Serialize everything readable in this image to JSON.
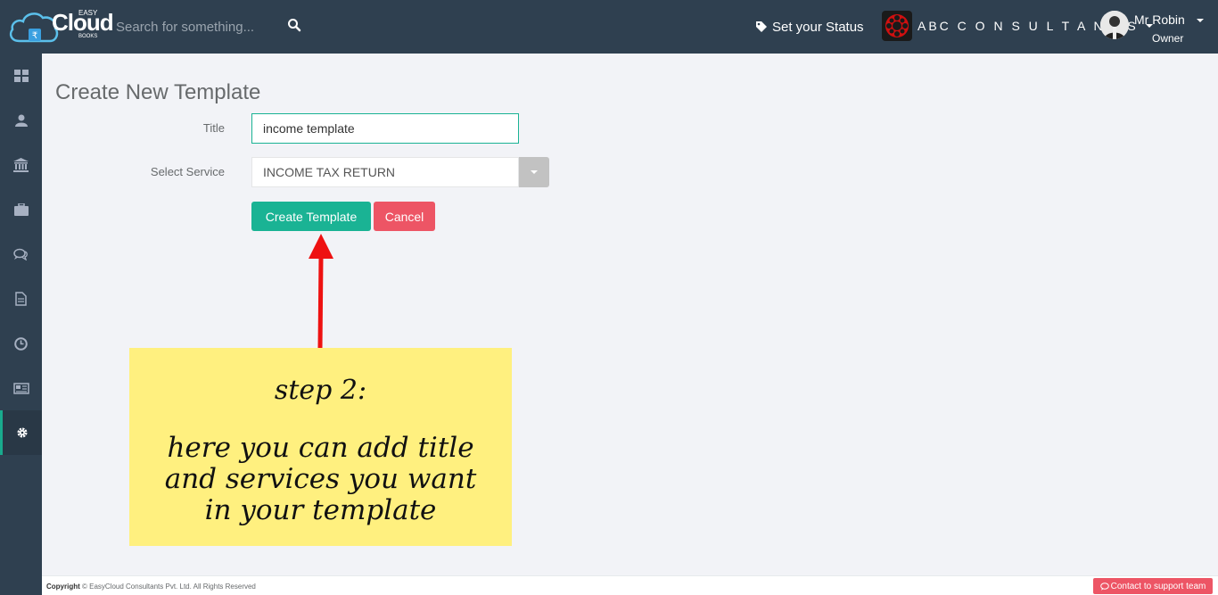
{
  "brand": {
    "easy": "EASY",
    "word": "Cloud",
    "books": "BOOKS"
  },
  "search": {
    "placeholder": "Search for something...",
    "value": ""
  },
  "header": {
    "status_label": "Set your Status",
    "company_name": "ABC C O N S U L T A N T S",
    "user_name": "Mr Robin",
    "user_role": "Owner"
  },
  "sidebar": {
    "items": [
      {
        "icon": "dashboard-icon"
      },
      {
        "icon": "user-icon"
      },
      {
        "icon": "bank-icon"
      },
      {
        "icon": "briefcase-icon"
      },
      {
        "icon": "chat-icon"
      },
      {
        "icon": "document-icon"
      },
      {
        "icon": "clock-icon"
      },
      {
        "icon": "newspaper-icon"
      },
      {
        "icon": "gear-icon",
        "active": true
      }
    ]
  },
  "form": {
    "page_title": "Create New Template",
    "title_label": "Title",
    "title_value": "income template",
    "service_label": "Select Service",
    "service_value": "INCOME TAX RETURN",
    "create_label": "Create Template",
    "cancel_label": "Cancel"
  },
  "annotation": {
    "step": "step 2:",
    "text": "here you can add title and services you want in your template"
  },
  "footer": {
    "copyright_bold": "Copyright",
    "copyright_text": " © EasyCloud Consultants Pvt. Ltd. All Rights Reserved",
    "support_label": "Contact to support team"
  },
  "colors": {
    "topbar": "#2f4050",
    "primary": "#1ab394",
    "danger": "#ed5565",
    "sticky": "#fff07f"
  }
}
